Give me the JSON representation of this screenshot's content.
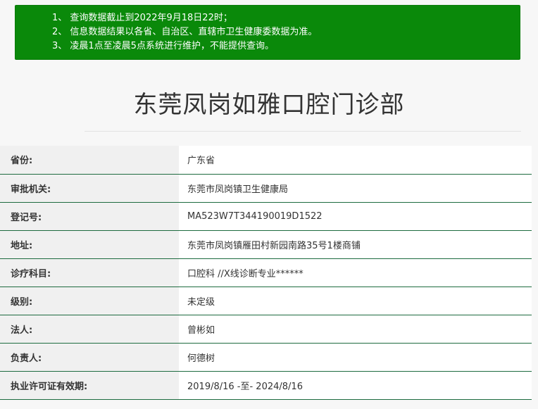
{
  "notice": {
    "lines": [
      "1、 查询数据截止到2022年9月18日22时；",
      "2、 信息数据结果以各省、自治区、直辖市卫生健康委数据为准。",
      "3、 凌晨1点至凌晨5点系统进行维护，不能提供查询。"
    ]
  },
  "title": "东莞凤岗如雅口腔门诊部",
  "rows": [
    {
      "label": "省份:",
      "value": "广东省"
    },
    {
      "label": "审批机关:",
      "value": "东莞市凤岗镇卫生健康局"
    },
    {
      "label": "登记号:",
      "value": "MA523W7T344190019D1522"
    },
    {
      "label": "地址:",
      "value": "东莞市凤岗镇雁田村新园南路35号1楼商铺"
    },
    {
      "label": "诊疗科目:",
      "value": "口腔科 //X线诊断专业******"
    },
    {
      "label": "级别:",
      "value": "未定级"
    },
    {
      "label": "法人:",
      "value": "曾彬如"
    },
    {
      "label": "负责人:",
      "value": "何德树"
    },
    {
      "label": "执业许可证有效期:",
      "value": "2019/8/16 -至- 2024/8/16"
    }
  ],
  "colors": {
    "notice_bg": "#0a890a",
    "row_border": "#1d6b3f"
  }
}
